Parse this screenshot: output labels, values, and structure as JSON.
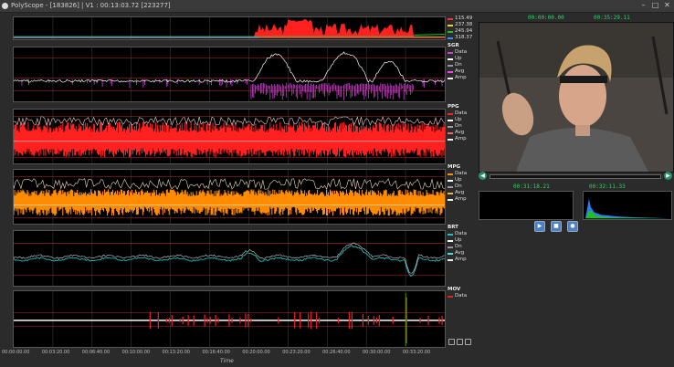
{
  "window": {
    "title": "PolyScope - [183826] | V1 : 00:13:03.72 [223277]"
  },
  "colors": {
    "panel_bg": "#000000",
    "grid": "#3a3a3a",
    "redline": "#b23030",
    "sgr": "#d040d0",
    "ppg": "#ff2020",
    "mpg": "#ff8c00",
    "brt": "#20c0c0",
    "mov": "#e02020",
    "timestamp": "#2fd36b"
  },
  "legends": {
    "overview": {
      "items": [
        "115.49",
        "237.38",
        "245.94",
        "318.37"
      ]
    },
    "sgr": {
      "title": "SGR",
      "items": [
        "Data",
        "Up",
        "Dn",
        "Avg",
        "Amp"
      ]
    },
    "ppg": {
      "title": "PPG",
      "items": [
        "Data",
        "Up",
        "Dn",
        "Avg",
        "Amp"
      ]
    },
    "mpg": {
      "title": "MPG",
      "items": [
        "Data",
        "Up",
        "Dn",
        "Avg",
        "Amp"
      ]
    },
    "brt": {
      "title": "BRT",
      "items": [
        "Data",
        "Up",
        "Dn",
        "Avg",
        "Amp"
      ]
    },
    "mov": {
      "title": "MOV",
      "items": [
        "Data"
      ]
    }
  },
  "time_axis": {
    "ticks": [
      "00:00:00.00",
      "00:03:20.00",
      "00:06:40.00",
      "00:10:00.00",
      "00:13:20.00",
      "00:16:40.00",
      "00:20:00.00",
      "00:23:20.00",
      "00:26:40.00",
      "00:30:00.00",
      "00:33:20.00"
    ],
    "title": "Time"
  },
  "video": {
    "time_left": "00:00:00.00",
    "time_right": "00:35:29.11",
    "cursor_time": "00:31:18.21",
    "cursor_total": "00:32:11.33"
  },
  "icons": {
    "seek_back": "rewind-icon",
    "seek_fwd": "forward-icon",
    "play": "play-icon",
    "stop": "stop-icon",
    "record": "record-icon"
  }
}
